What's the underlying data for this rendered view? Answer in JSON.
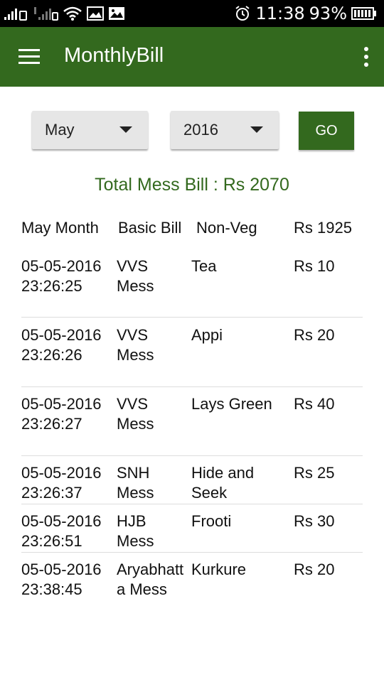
{
  "status_bar": {
    "time": "11:38",
    "battery": "93%",
    "icons": [
      "signal-icon",
      "signal-icon",
      "sim-icon",
      "wifi-icon",
      "image-icon",
      "image-icon",
      "alarm-icon",
      "battery-icon"
    ]
  },
  "app_bar": {
    "title": "MonthlyBill",
    "color": "#33691e"
  },
  "filters": {
    "month": "May",
    "year": "2016",
    "go_label": "GO"
  },
  "summary": {
    "total_label": "Total Mess Bill : Rs 2070"
  },
  "basic_row": {
    "month": "May Month",
    "type": "Basic Bill",
    "category": "Non-Veg",
    "amount": "Rs 1925"
  },
  "entries": [
    {
      "datetime": "05-05-2016\n23:26:25",
      "mess": "VVS\nMess",
      "item": "Tea",
      "amount": "Rs 10"
    },
    {
      "datetime": "05-05-2016\n23:26:26",
      "mess": "VVS\nMess",
      "item": "Appi",
      "amount": "Rs 20"
    },
    {
      "datetime": "05-05-2016\n23:26:27",
      "mess": "VVS\nMess",
      "item": "Lays Green",
      "amount": "Rs 40"
    },
    {
      "datetime": "05-05-2016\n23:26:37",
      "mess": "SNH\nMess",
      "item": "Hide and\nSeek",
      "amount": "Rs 25"
    },
    {
      "datetime": "05-05-2016\n23:26:51",
      "mess": "HJB\nMess",
      "item": "Frooti",
      "amount": "Rs 30"
    },
    {
      "datetime": "05-05-2016\n23:38:45",
      "mess": "Aryabhatt\na Mess",
      "item": "Kurkure",
      "amount": "Rs 20"
    }
  ]
}
